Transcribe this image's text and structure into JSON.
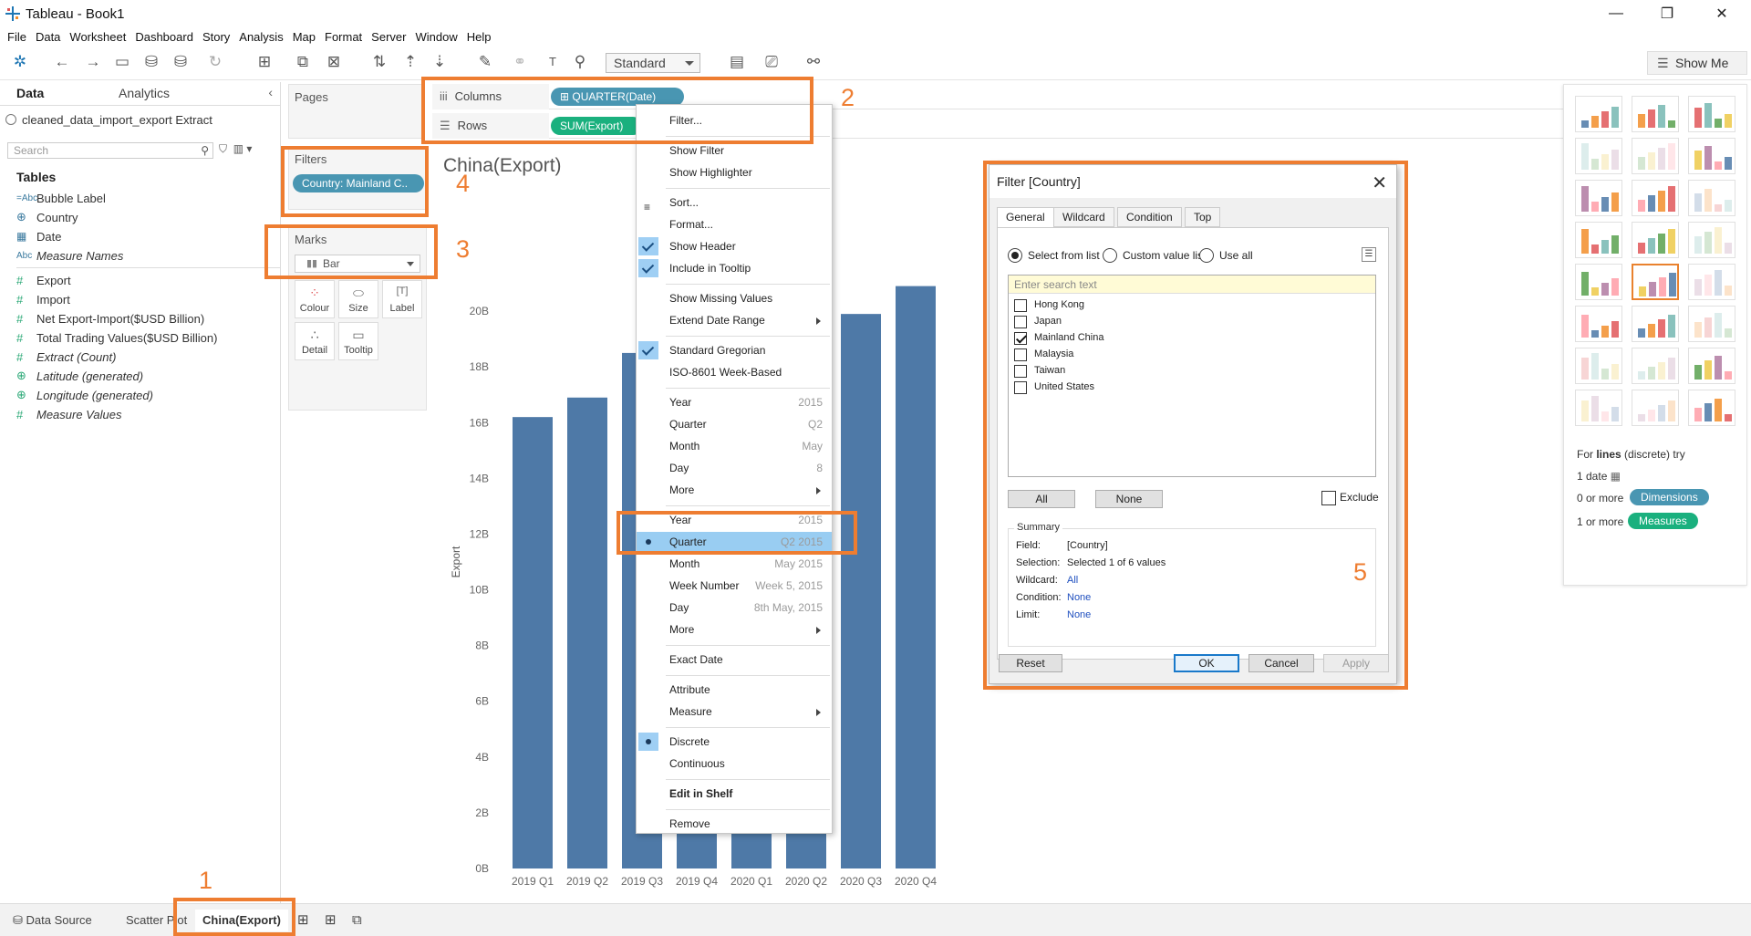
{
  "window": {
    "title": "Tableau - Book1",
    "minimize": "—",
    "restore": "❐",
    "close": "✕"
  },
  "menubar": [
    "File",
    "Data",
    "Worksheet",
    "Dashboard",
    "Story",
    "Analysis",
    "Map",
    "Format",
    "Server",
    "Window",
    "Help"
  ],
  "toolbar": {
    "fit_select": "Standard",
    "show_me": "Show Me"
  },
  "data_pane": {
    "tab_data": "Data",
    "tab_analytics": "Analytics",
    "datasource": "cleaned_data_import_export Extract",
    "search_placeholder": "Search",
    "tables_header": "Tables",
    "dimensions": [
      {
        "icon": "=Abc",
        "name": "Bubble Label"
      },
      {
        "icon": "⊕",
        "name": "Country"
      },
      {
        "icon": "▦",
        "name": "Date"
      },
      {
        "icon": "Abc",
        "name": "Measure Names"
      }
    ],
    "measures": [
      {
        "icon": "#",
        "name": "Export"
      },
      {
        "icon": "#",
        "name": "Import"
      },
      {
        "icon": "#",
        "name": "Net Export-Import($USD Billion)"
      },
      {
        "icon": "#",
        "name": "Total Trading Values($USD Billion)"
      },
      {
        "icon": "#",
        "name": "Extract (Count)"
      },
      {
        "icon": "⊕",
        "name": "Latitude (generated)"
      },
      {
        "icon": "⊕",
        "name": "Longitude (generated)"
      },
      {
        "icon": "#",
        "name": "Measure Values"
      }
    ]
  },
  "shelves": {
    "pages": "Pages",
    "filters": "Filters",
    "filter_pill": "Country: Mainland C..",
    "marks": "Marks",
    "mark_type": "Bar",
    "mark_buttons": [
      "Colour",
      "Size",
      "Label",
      "Detail",
      "Tooltip"
    ],
    "columns_label": "Columns",
    "rows_label": "Rows",
    "columns_pill": "⊞ QUARTER(Date)",
    "rows_pill": "SUM(Export)"
  },
  "viz": {
    "title": "China(Export)",
    "header_fragment": "t"
  },
  "chart_data": {
    "type": "bar",
    "title": "China(Export)",
    "ylabel": "Export",
    "xlabel": "",
    "categories": [
      "2019 Q1",
      "2019 Q2",
      "2019 Q3",
      "2019 Q4",
      "2020 Q1",
      "2020 Q2",
      "2020 Q3",
      "2020 Q4"
    ],
    "values": [
      16.2,
      16.9,
      18.5,
      20.0,
      19.0,
      19.5,
      19.9,
      20.9
    ],
    "ylim": [
      0,
      22
    ],
    "yticks": [
      "0B",
      "2B",
      "4B",
      "6B",
      "8B",
      "10B",
      "12B",
      "14B",
      "16B",
      "18B",
      "20B"
    ],
    "bar_color": "#4e79a7",
    "grid": false
  },
  "context_menu": {
    "items": [
      {
        "label": "Filter...",
        "type": "item"
      },
      {
        "type": "sep"
      },
      {
        "label": "Show Filter",
        "type": "item"
      },
      {
        "label": "Show Highlighter",
        "type": "item"
      },
      {
        "type": "sep"
      },
      {
        "label": "Sort...",
        "type": "item",
        "icon": "sort"
      },
      {
        "label": "Format...",
        "type": "item"
      },
      {
        "label": "Show Header",
        "type": "check"
      },
      {
        "label": "Include in Tooltip",
        "type": "check"
      },
      {
        "type": "sep"
      },
      {
        "label": "Show Missing Values",
        "type": "item"
      },
      {
        "label": "Extend Date Range",
        "type": "sub"
      },
      {
        "type": "sep"
      },
      {
        "label": "Standard Gregorian",
        "type": "check"
      },
      {
        "label": "ISO-8601 Week-Based",
        "type": "item"
      },
      {
        "type": "sep"
      },
      {
        "label": "Year",
        "type": "item",
        "right": "2015"
      },
      {
        "label": "Quarter",
        "type": "item",
        "right": "Q2"
      },
      {
        "label": "Month",
        "type": "item",
        "right": "May"
      },
      {
        "label": "Day",
        "type": "item",
        "right": "8"
      },
      {
        "label": "More",
        "type": "sub"
      },
      {
        "type": "sep"
      },
      {
        "label": "Year",
        "type": "item",
        "right": "2015"
      },
      {
        "label": "Quarter",
        "type": "dot-hl",
        "right": "Q2 2015"
      },
      {
        "label": "Month",
        "type": "item",
        "right": "May 2015"
      },
      {
        "label": "Week Number",
        "type": "item",
        "right": "Week 5, 2015"
      },
      {
        "label": "Day",
        "type": "item",
        "right": "8th May, 2015"
      },
      {
        "label": "More",
        "type": "sub"
      },
      {
        "type": "sep"
      },
      {
        "label": "Exact Date",
        "type": "item"
      },
      {
        "type": "sep"
      },
      {
        "label": "Attribute",
        "type": "item"
      },
      {
        "label": "Measure",
        "type": "sub"
      },
      {
        "type": "sep"
      },
      {
        "label": "Discrete",
        "type": "dot"
      },
      {
        "label": "Continuous",
        "type": "item"
      },
      {
        "type": "sep"
      },
      {
        "label": "Edit in Shelf",
        "type": "bold"
      },
      {
        "type": "sep"
      },
      {
        "label": "Remove",
        "type": "item"
      }
    ]
  },
  "show_me": {
    "hint_prefix": "For",
    "hint_bold": "lines",
    "hint_suffix": "(discrete) try",
    "req1": "1 date",
    "req2": "0 or more",
    "req2_pill": "Dimensions",
    "req3": "1 or more",
    "req3_pill": "Measures",
    "dim_color": "#4996b2",
    "meas_color": "#1ab07e"
  },
  "filter_dialog": {
    "title": "Filter [Country]",
    "tabs": [
      "General",
      "Wildcard",
      "Condition",
      "Top"
    ],
    "radio_select": "Select from list",
    "radio_custom": "Custom value list",
    "radio_all": "Use all",
    "search_placeholder": "Enter search text",
    "items": [
      {
        "label": "Hong Kong",
        "checked": false
      },
      {
        "label": "Japan",
        "checked": false
      },
      {
        "label": "Mainland China",
        "checked": true
      },
      {
        "label": "Malaysia",
        "checked": false
      },
      {
        "label": "Taiwan",
        "checked": false
      },
      {
        "label": "United States",
        "checked": false
      }
    ],
    "btn_all": "All",
    "btn_none": "None",
    "exclude": "Exclude",
    "summary_title": "Summary",
    "summary": [
      {
        "k": "Field:",
        "v": "[Country]",
        "link": false
      },
      {
        "k": "Selection:",
        "v": "Selected 1 of 6 values",
        "link": false
      },
      {
        "k": "Wildcard:",
        "v": "All",
        "link": true
      },
      {
        "k": "Condition:",
        "v": "None",
        "link": true
      },
      {
        "k": "Limit:",
        "v": "None",
        "link": true
      }
    ],
    "btn_reset": "Reset",
    "btn_ok": "OK",
    "btn_cancel": "Cancel",
    "btn_apply": "Apply"
  },
  "annotations": [
    "1",
    "2",
    "3",
    "4",
    "5"
  ],
  "annotation_color": "#ee7d31",
  "sheet_tabs": {
    "data_source": "Data Source",
    "scatter": "Scatter Plot",
    "active": "China(Export)"
  }
}
